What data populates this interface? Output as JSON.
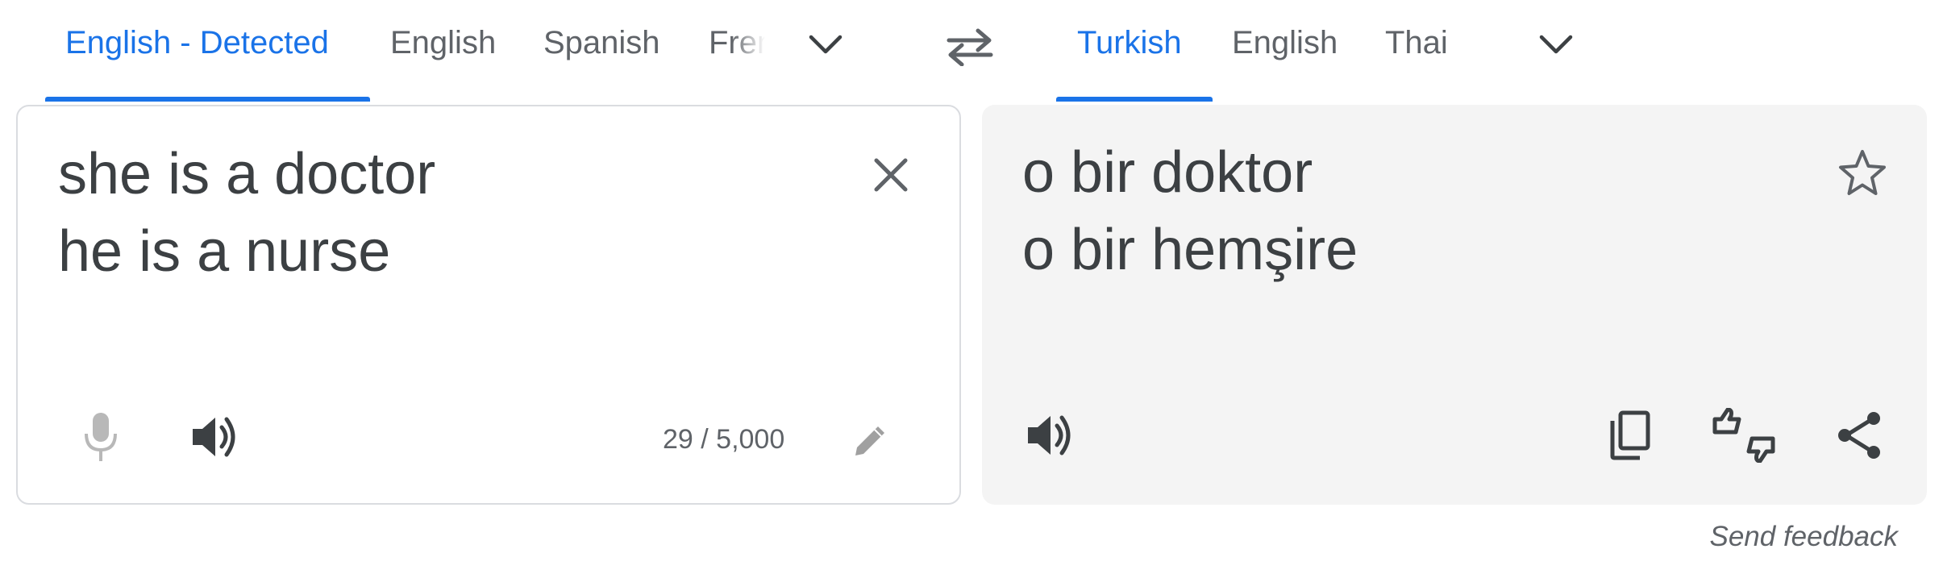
{
  "source_languages": {
    "tabs": [
      {
        "label": "English - Detected",
        "active": true
      },
      {
        "label": "English",
        "active": false
      },
      {
        "label": "Spanish",
        "active": false
      },
      {
        "label": "French",
        "active": false
      }
    ],
    "more_icon": "chevron-down-icon"
  },
  "swap_icon": "swap-arrows-icon",
  "target_languages": {
    "tabs": [
      {
        "label": "Turkish",
        "active": true
      },
      {
        "label": "English",
        "active": false
      },
      {
        "label": "Thai",
        "active": false
      }
    ],
    "more_icon": "chevron-down-icon"
  },
  "source_panel": {
    "lines": [
      "she is a doctor",
      "he is a nurse"
    ],
    "char_count": "29 / 5,000",
    "icons": [
      "close-icon",
      "microphone-icon",
      "speaker-icon",
      "pencil-icon"
    ]
  },
  "target_panel": {
    "lines": [
      "o bir doktor",
      "o bir hemşire"
    ],
    "icons": [
      "star-icon",
      "speaker-icon",
      "copy-icon",
      "rate-translation-icon",
      "share-icon"
    ]
  },
  "footer": {
    "feedback_link": "Send feedback"
  },
  "colors": {
    "accent": "#1a73e8",
    "text": "#3c4043",
    "muted": "#5f6368",
    "target_bg": "#f4f4f4"
  }
}
